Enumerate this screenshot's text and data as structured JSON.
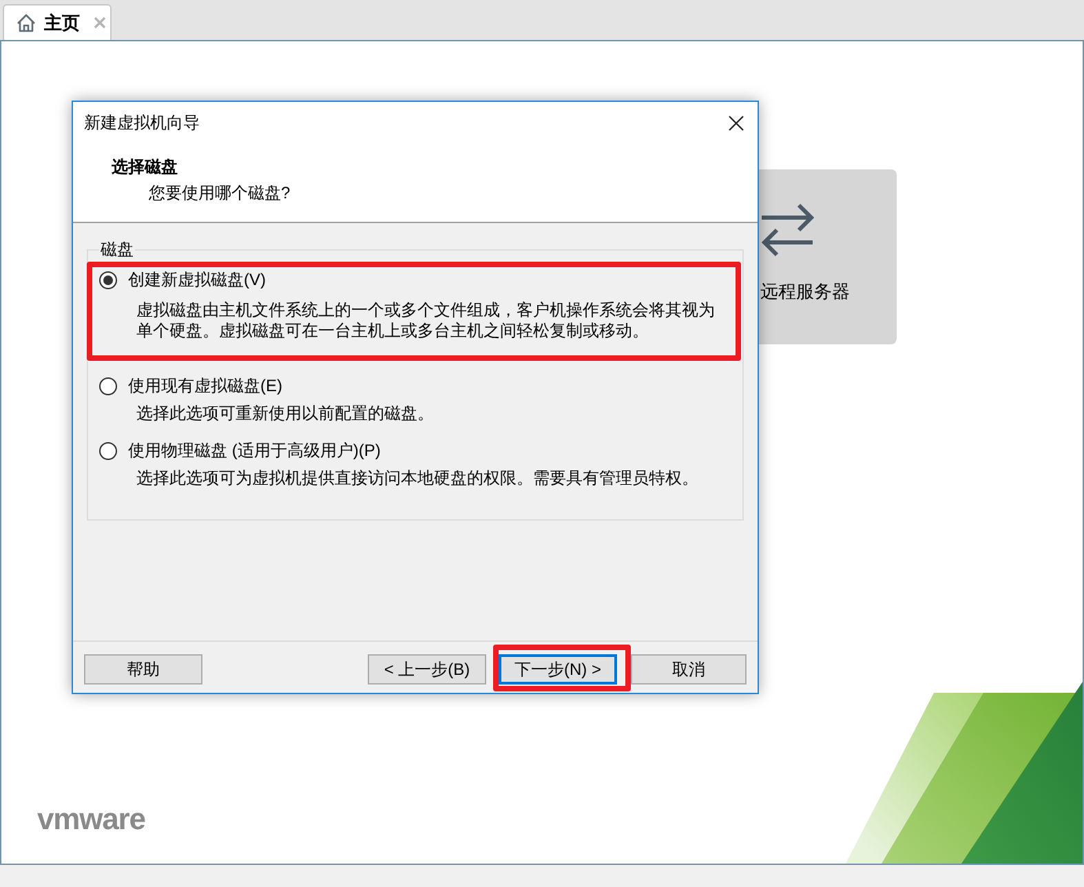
{
  "tabs": [
    {
      "label": "主页",
      "selected": true
    }
  ],
  "home": {
    "tiles": [
      {
        "label": "远程服务器"
      }
    ],
    "logo": "vmware"
  },
  "dialog": {
    "title": "新建虚拟机向导",
    "heading": "选择磁盘",
    "subheading": "您要使用哪个磁盘?",
    "group": {
      "label": "磁盘",
      "options": [
        {
          "label": "创建新虚拟磁盘(V)",
          "description": "虚拟磁盘由主机文件系统上的一个或多个文件组成，客户机操作系统会将其视为单个硬盘。虚拟磁盘可在一台主机上或多台主机之间轻松复制或移动。",
          "selected": true,
          "highlighted": true
        },
        {
          "label": "使用现有虚拟磁盘(E)",
          "description": "选择此选项可重新使用以前配置的磁盘。",
          "selected": false,
          "highlighted": false
        },
        {
          "label": "使用物理磁盘 (适用于高级用户)(P)",
          "description": "选择此选项可为虚拟机提供直接访问本地硬盘的权限。需要具有管理员特权。",
          "selected": false,
          "highlighted": false
        }
      ]
    },
    "buttons": [
      {
        "label": "帮助",
        "kind": "help",
        "focused": false,
        "highlighted": false
      },
      {
        "label": "< 上一步(B)",
        "kind": "back",
        "focused": false,
        "highlighted": false
      },
      {
        "label": "下一步(N) >",
        "kind": "next",
        "focused": true,
        "highlighted": true
      },
      {
        "label": "取消",
        "kind": "cancel",
        "focused": false,
        "highlighted": false
      }
    ]
  }
}
